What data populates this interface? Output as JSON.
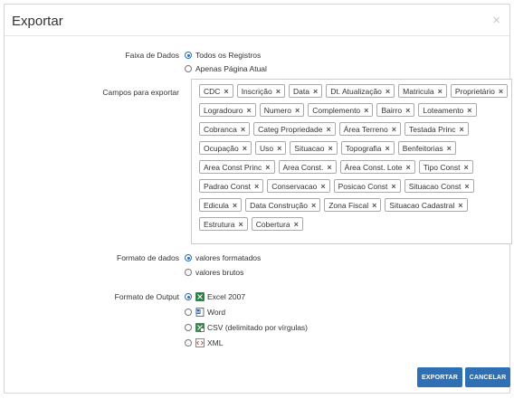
{
  "dialog": {
    "title": "Exportar",
    "close_glyph": "×"
  },
  "data_range": {
    "label": "Faixa de Dados",
    "options": [
      {
        "label": "Todos os Registros",
        "selected": true
      },
      {
        "label": "Apenas Página Atual",
        "selected": false
      }
    ]
  },
  "fields": {
    "label": "Campos para exportar",
    "remove_glyph": "×",
    "tags": [
      "CDC",
      "Inscrição",
      "Data",
      "Dt. Atualização",
      "Matricula",
      "Proprietário",
      "Logradouro",
      "Numero",
      "Complemento",
      "Bairro",
      "Loteamento",
      "Cobranca",
      "Categ Propriedade",
      "Área Terreno",
      "Testada Princ",
      "Ocupação",
      "Uso",
      "Situacao",
      "Topografia",
      "Benfeitorias",
      "Area Const Princ",
      "Area Const.",
      "Área Const. Lote",
      "Tipo Const",
      "Padrao Const",
      "Conservacao",
      "Posicao Const",
      "Situacao Const",
      "Edicula",
      "Data Construção",
      "Zona Fiscal",
      "Situacao Cadastral",
      "Estrutura",
      "Cobertura"
    ]
  },
  "data_format": {
    "label": "Formato de dados",
    "options": [
      {
        "label": "valores formatados",
        "selected": true
      },
      {
        "label": "valores brutos",
        "selected": false
      }
    ]
  },
  "output_format": {
    "label": "Formato de Output",
    "options": [
      {
        "label": "Excel 2007",
        "selected": true,
        "icon": "excel-icon"
      },
      {
        "label": "Word",
        "selected": false,
        "icon": "word-icon"
      },
      {
        "label": "CSV (delimitado por vírgulas)",
        "selected": false,
        "icon": "csv-icon"
      },
      {
        "label": "XML",
        "selected": false,
        "icon": "xml-icon"
      }
    ]
  },
  "buttons": {
    "export": "EXPORTAR",
    "cancel": "CANCELAR"
  },
  "colors": {
    "primary": "#2f6fb3",
    "radio_selected": "#2a6ebb"
  }
}
